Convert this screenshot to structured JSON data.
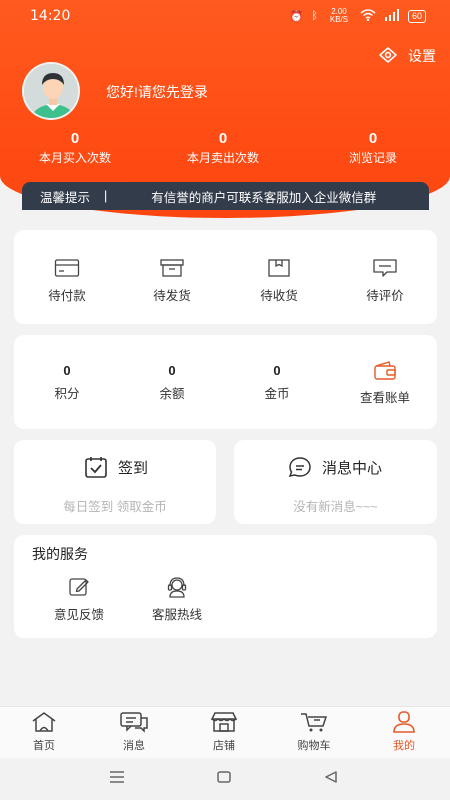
{
  "status_bar": {
    "time": "14:20",
    "net_speed": "2.00 KB/S",
    "battery": "60"
  },
  "header": {
    "settings_label": "设置",
    "greeting": "您好!请您先登录",
    "stats": [
      {
        "value": "0",
        "label": "本月买入次数"
      },
      {
        "value": "0",
        "label": "本月卖出次数"
      },
      {
        "value": "0",
        "label": "浏览记录"
      }
    ],
    "notice": {
      "title": "温馨提示",
      "separator": "|",
      "message": "有信誉的商户可联系客服加入企业微信群"
    }
  },
  "orders": [
    {
      "label": "待付款",
      "icon": "card-icon"
    },
    {
      "label": "待发货",
      "icon": "box-icon"
    },
    {
      "label": "待收货",
      "icon": "package-icon"
    },
    {
      "label": "待评价",
      "icon": "comment-icon"
    }
  ],
  "wallet": {
    "items": [
      {
        "value": "0",
        "label": "积分"
      },
      {
        "value": "0",
        "label": "余额"
      },
      {
        "value": "0",
        "label": "金币"
      }
    ],
    "bill_label": "查看账单"
  },
  "checkin": {
    "title": "签到",
    "subtitle": "每日签到 领取金币"
  },
  "messages": {
    "title": "消息中心",
    "subtitle": "没有新消息~~~"
  },
  "services": {
    "title": "我的服务",
    "items": [
      {
        "label": "意见反馈",
        "icon": "edit-icon"
      },
      {
        "label": "客服热线",
        "icon": "headset-icon"
      }
    ]
  },
  "tabs": [
    {
      "label": "首页",
      "icon": "home-icon"
    },
    {
      "label": "消息",
      "icon": "chat-icon"
    },
    {
      "label": "店铺",
      "icon": "store-icon"
    },
    {
      "label": "购物车",
      "icon": "cart-icon"
    },
    {
      "label": "我的",
      "icon": "user-icon",
      "active": true
    }
  ],
  "colors": {
    "accent": "#ff4d14",
    "active_tab": "#e55a28",
    "notice_bg": "#333c4a"
  }
}
